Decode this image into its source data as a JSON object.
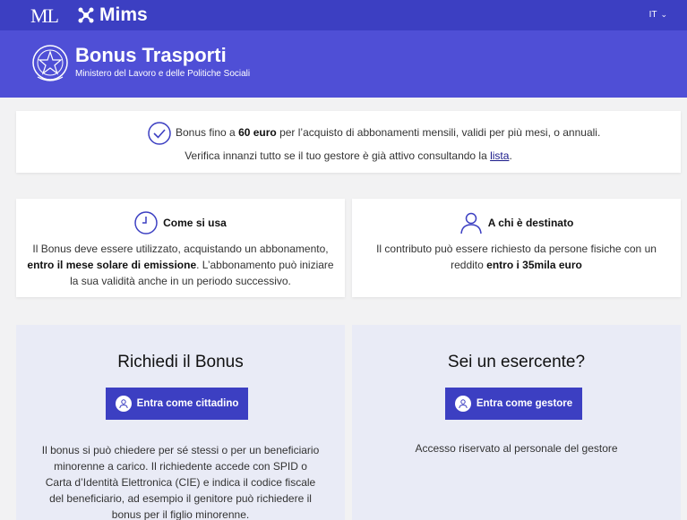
{
  "topbar": {
    "logo_text": "ML",
    "brand": "Mims",
    "language": "IT",
    "background": "#3c3fc2"
  },
  "header": {
    "title": "Bonus Trasporti",
    "subtitle": "Ministero del Lavoro e delle Politiche Sociali",
    "background": "#4f4fd6",
    "emblem_icon": "italian-republic-emblem-icon"
  },
  "intro": {
    "icon": "check-circle-icon",
    "line1_before": "Bonus fino a ",
    "line1_bold": "60 euro",
    "line1_after": " per l’acquisto di abbonamenti mensili, validi per più mesi, o annuali.",
    "line2_before": "Verifica innanzi tutto se il tuo gestore è già attivo consultando la ",
    "line2_link": "lista",
    "line2_after": "."
  },
  "how": {
    "icon": "clock-icon",
    "title": "Come si usa",
    "text_before": "Il Bonus deve essere utilizzato, acquistando un abbonamento, ",
    "text_bold": "entro il mese solare di emissione",
    "text_after": ". L’abbonamento può iniziare la sua validità anche in un periodo successivo."
  },
  "who": {
    "icon": "person-icon",
    "title": "A chi è destinato",
    "text_before": "Il contributo può essere richiesto da persone fisiche con un reddito ",
    "text_bold": "entro i 35mila euro"
  },
  "request": {
    "title": "Richiedi il Bonus",
    "button_label": "Entra come cittadino",
    "button_icon": "user-avatar-icon",
    "body": "Il bonus si può chiedere per sé stessi o per un beneficiario minorenne a carico. Il richiedente accede con SPID o Carta d’Identità Elettronica (CIE) e indica il codice fiscale del beneficiario, ad esempio il genitore può richiedere il bonus per il figlio minorenne."
  },
  "merchant": {
    "title": "Sei un esercente?",
    "button_label": "Entra come gestore",
    "button_icon": "user-avatar-icon",
    "body": "Accesso riservato al personale del gestore"
  },
  "colors": {
    "accent": "#3c3fc2",
    "page_bg": "#f2f2f3",
    "box_bg": "#e9ebf6"
  }
}
